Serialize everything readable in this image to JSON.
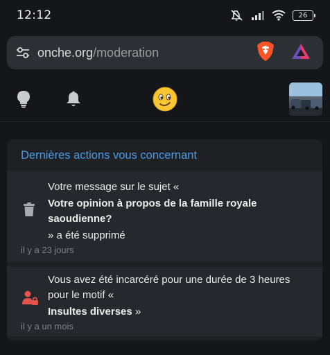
{
  "status_bar": {
    "time": "12:12",
    "battery_level": "26",
    "icons": [
      "mute-icon",
      "signal-icon",
      "wifi-icon",
      "battery-icon"
    ]
  },
  "url_bar": {
    "domain": "onche.org",
    "path": "/moderation",
    "icons": [
      "site-settings-icon",
      "brave-shield-icon",
      "brave-rewards-icon"
    ]
  },
  "toolbar": {
    "icons": [
      "lightbulb-icon",
      "bell-icon",
      "smiley-icon",
      "avatar"
    ]
  },
  "card": {
    "title": "Dernières actions vous concernant",
    "notifications": [
      {
        "icon": "trash-icon",
        "line1": "Votre message sur le sujet «",
        "subject": "Votre opinion à propos de la famille royale saoudienne?",
        "line3": "» a été supprimé",
        "time": "il y a 23 jours"
      },
      {
        "icon": "user-locked-icon",
        "line1": "Vous avez été incarcéré pour une durée de 3 heures pour le motif «",
        "reason": "Insultes diverses",
        "reason_suffix": " »",
        "time": "il y a un mois"
      }
    ]
  },
  "colors": {
    "accent": "#4c9be8",
    "danger": "#e5534b",
    "background": "#141619",
    "card": "#1e2024"
  }
}
